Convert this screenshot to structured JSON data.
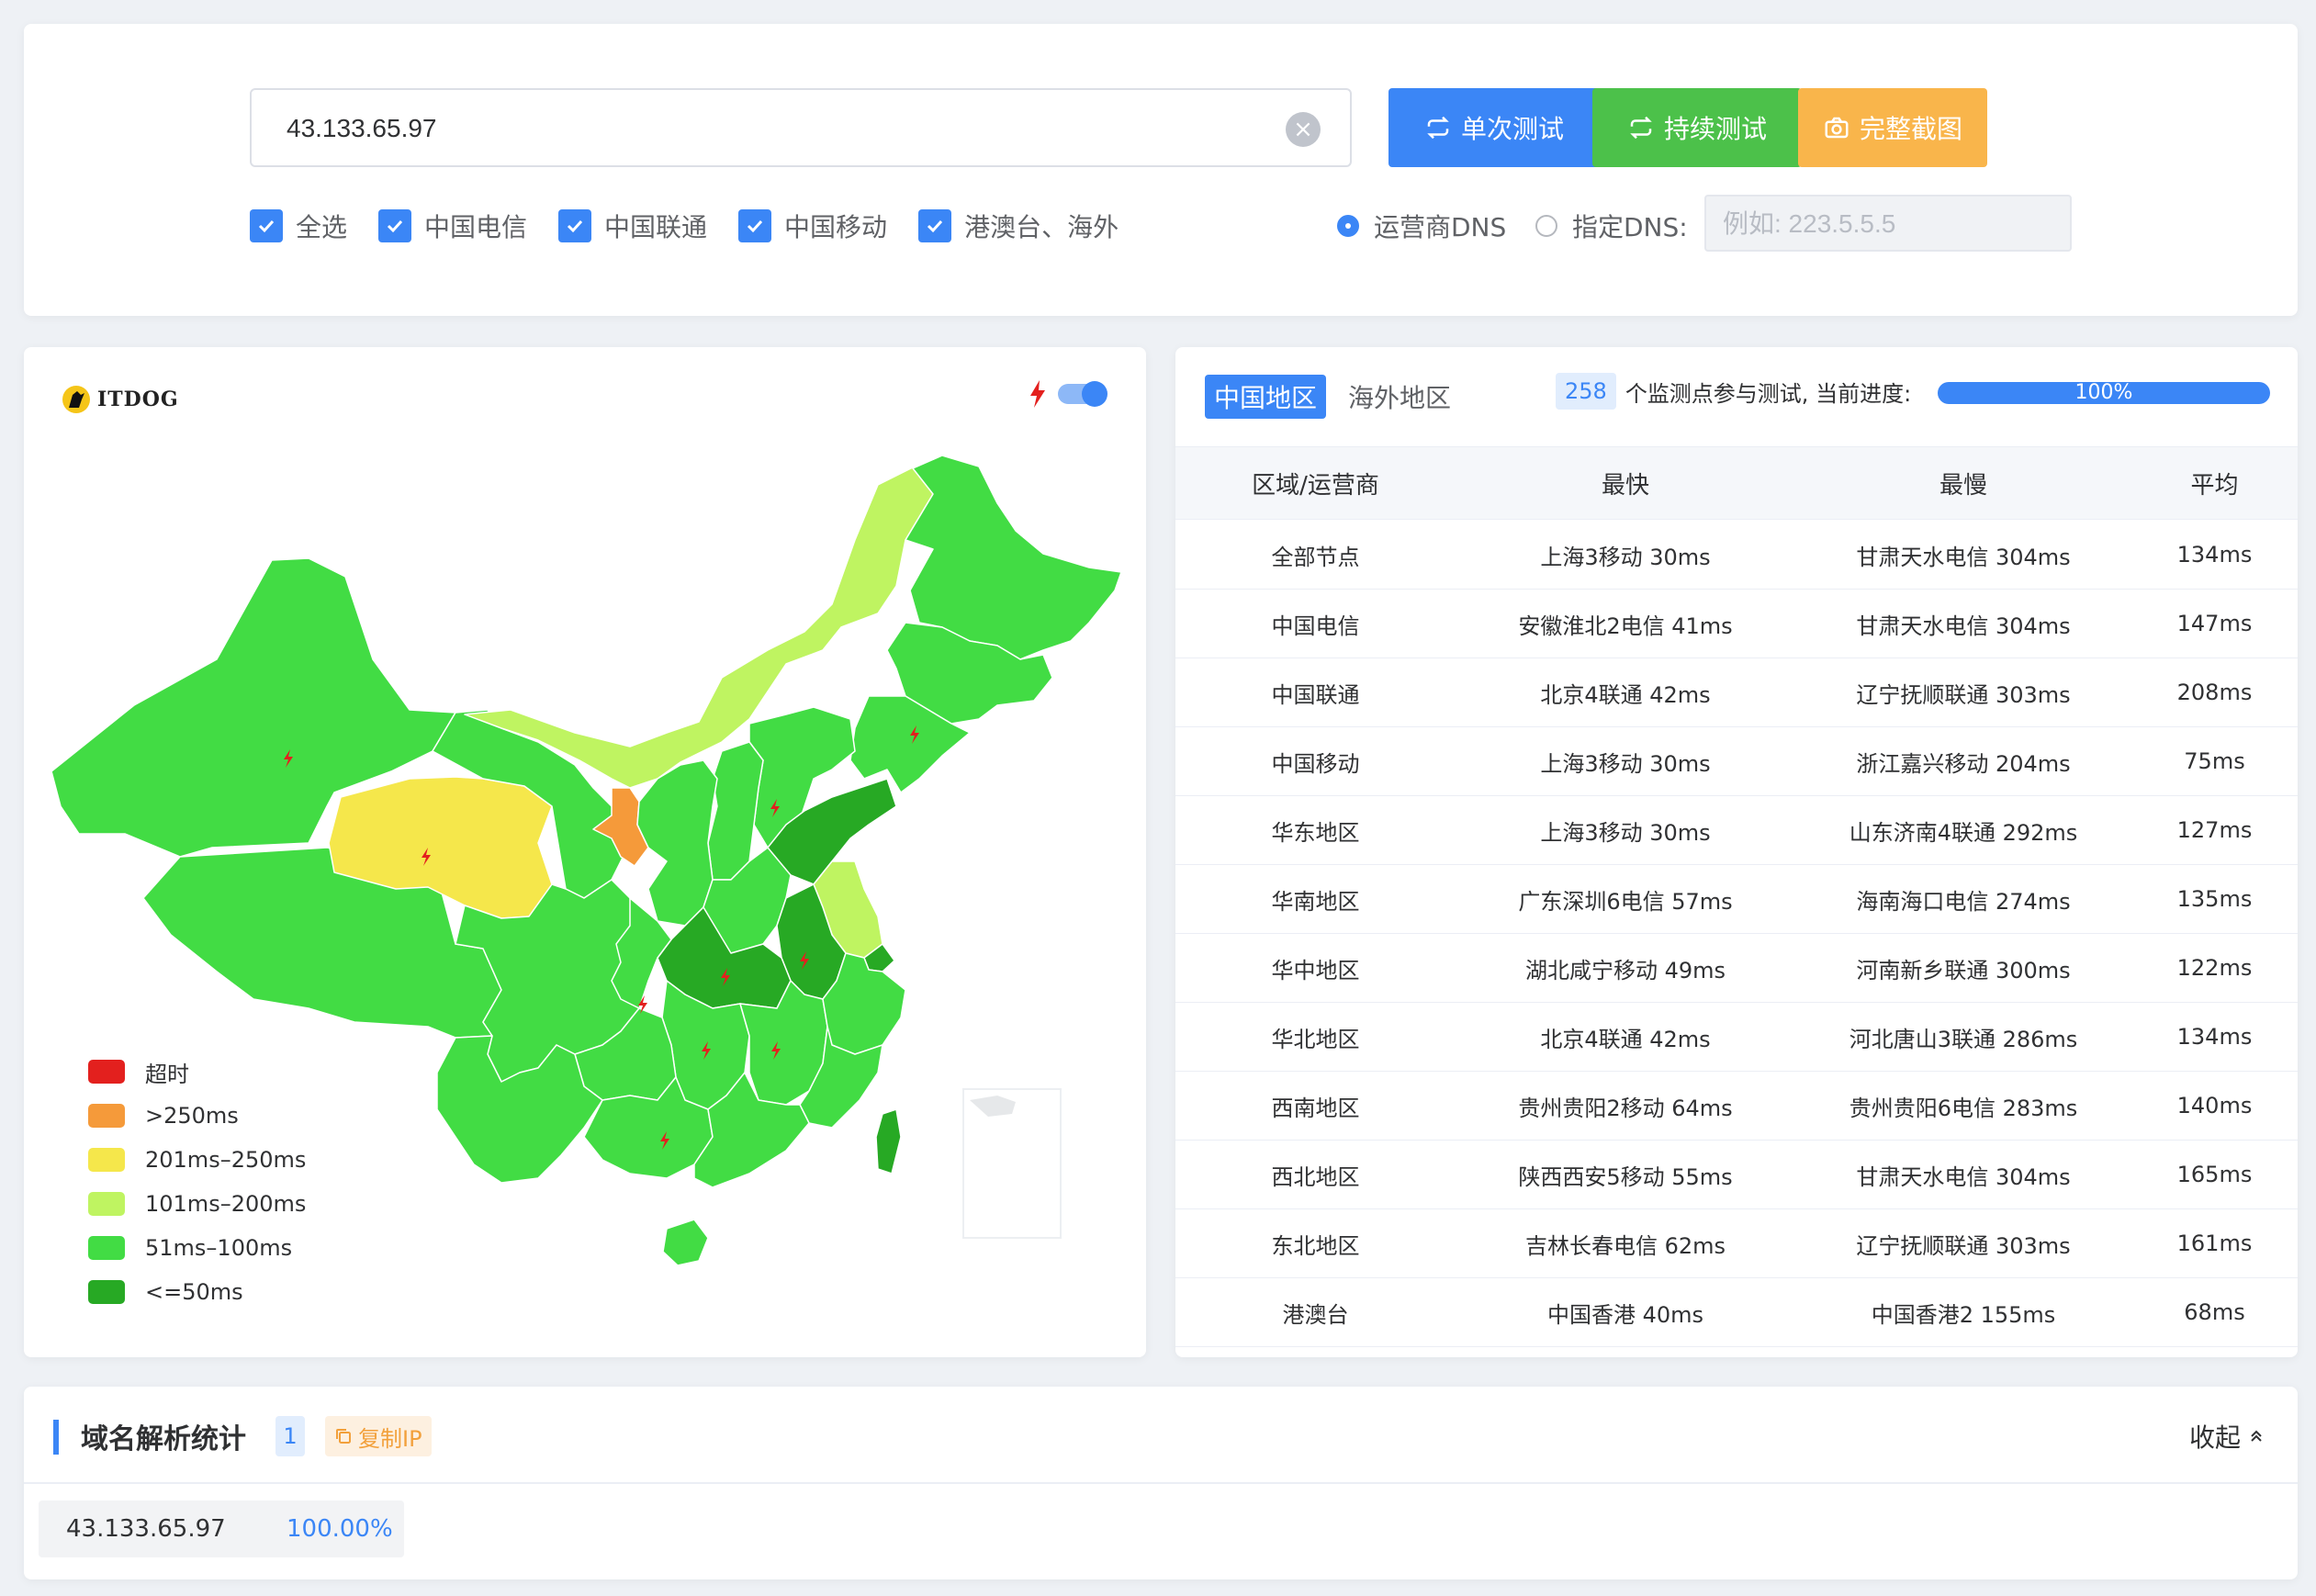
{
  "top": {
    "ip_value": "43.133.65.97",
    "buttons": {
      "single": "单次测试",
      "continuous": "持续测试",
      "screenshot": "完整截图"
    },
    "checkboxes": [
      "全选",
      "中国电信",
      "中国联通",
      "中国移动",
      "港澳台、海外"
    ],
    "dns": {
      "isp_label": "运营商DNS",
      "custom_label": "指定DNS:",
      "placeholder": "例如: 223.5.5.5"
    }
  },
  "map": {
    "logo_text": "ITDOG",
    "legend": [
      {
        "label": "超时",
        "color": "#e3201e"
      },
      {
        "label": ">250ms",
        "color": "#f59a3a"
      },
      {
        "label": "201ms–250ms",
        "color": "#f5e74b"
      },
      {
        "label": "101ms–200ms",
        "color": "#bff461"
      },
      {
        "label": "51ms–100ms",
        "color": "#42dc44"
      },
      {
        "label": "<=50ms",
        "color": "#27a924"
      }
    ]
  },
  "stats": {
    "tabs": [
      "中国地区",
      "海外地区"
    ],
    "monitor_count": "258",
    "monitor_text": "个监测点参与测试, 当前进度:",
    "progress_label": "100%",
    "progress_value": 1.0,
    "headers": [
      "区域/运营商",
      "最快",
      "最慢",
      "平均"
    ],
    "rows": [
      [
        "全部节点",
        "上海3移动 30ms",
        "甘肃天水电信 304ms",
        "134ms"
      ],
      [
        "中国电信",
        "安徽淮北2电信 41ms",
        "甘肃天水电信 304ms",
        "147ms"
      ],
      [
        "中国联通",
        "北京4联通 42ms",
        "辽宁抚顺联通 303ms",
        "208ms"
      ],
      [
        "中国移动",
        "上海3移动 30ms",
        "浙江嘉兴移动 204ms",
        "75ms"
      ],
      [
        "华东地区",
        "上海3移动 30ms",
        "山东济南4联通 292ms",
        "127ms"
      ],
      [
        "华南地区",
        "广东深圳6电信 57ms",
        "海南海口电信 274ms",
        "135ms"
      ],
      [
        "华中地区",
        "湖北咸宁移动 49ms",
        "河南新乡联通 300ms",
        "122ms"
      ],
      [
        "华北地区",
        "北京4联通 42ms",
        "河北唐山3联通 286ms",
        "134ms"
      ],
      [
        "西南地区",
        "贵州贵阳2移动 64ms",
        "贵州贵阳6电信 283ms",
        "140ms"
      ],
      [
        "西北地区",
        "陕西西安5移动 55ms",
        "甘肃天水电信 304ms",
        "165ms"
      ],
      [
        "东北地区",
        "吉林长春电信 62ms",
        "辽宁抚顺联通 303ms",
        "161ms"
      ],
      [
        "港澳台",
        "中国香港 40ms",
        "中国香港2 155ms",
        "68ms"
      ]
    ]
  },
  "domain": {
    "title": "域名解析统计",
    "count": "1",
    "copy_label": "复制IP",
    "collapse_label": "收起",
    "ip": "43.133.65.97",
    "percent": "100.00%"
  }
}
